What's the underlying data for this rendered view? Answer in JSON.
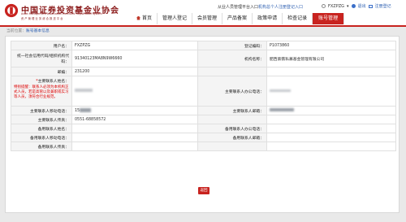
{
  "header": {
    "brand_cn": "中国证券投资基金业协会",
    "brand_en": "Asset Management Association Electronic Registration System",
    "brand_sub": "资产管理业务综合报送平台",
    "top_prefix": "从业人员管理平台入口",
    "top_link": "机构总个人注册登记入口",
    "user": "FXZPZG",
    "logout": "退出",
    "mail": "注册登记"
  },
  "nav": {
    "items": [
      "首页",
      "管理人登记",
      "会员管理",
      "产品备案",
      "政策申请",
      "检查记录"
    ],
    "active": "账号管理"
  },
  "breadcrumb": {
    "prefix": "当前位置：",
    "current": "账号基本信息"
  },
  "form": {
    "rows": [
      {
        "l1": "用户名：",
        "v1": "FXZPZG",
        "l2": "登记编码：",
        "v2": "P1073860"
      },
      {
        "l1": "统一社会信用代码/组织机构代码：",
        "v1": "91340123MA8N9W6660",
        "l2": "机构名称：",
        "v2": "肥西紫薇私募基金管理有限公司"
      },
      {
        "l1": "邮编：",
        "v1": "231200",
        "l2": "",
        "v2": ""
      },
      {
        "l1": "主要联系人姓名：",
        "v1": "",
        "l2": "主要联系人办公电话：",
        "v2": ""
      },
      {
        "l1": "主要联系人移动电话：",
        "v1": "15",
        "l2": "主要联系人邮箱：",
        "v2": ""
      },
      {
        "l1": "主要联系人传真：",
        "v1": "0551-68858572",
        "l2": "",
        "v2": ""
      },
      {
        "l1": "备用联系人姓名：",
        "v1": "",
        "l2": "备用联系人办公电话：",
        "v2": ""
      },
      {
        "l1": "备用联系人移动电话：",
        "v1": "",
        "l2": "备用联系人邮箱：",
        "v2": ""
      },
      {
        "l1": "备用联系人传真：",
        "v1": "",
        "l2": "",
        "v2": ""
      }
    ],
    "req_mark": "*",
    "warning": "特别提醒：联系人必须为本机构正式人员，若是高管以及兼职或实习等人员，须符合行业规范。"
  },
  "return_label": "返回"
}
